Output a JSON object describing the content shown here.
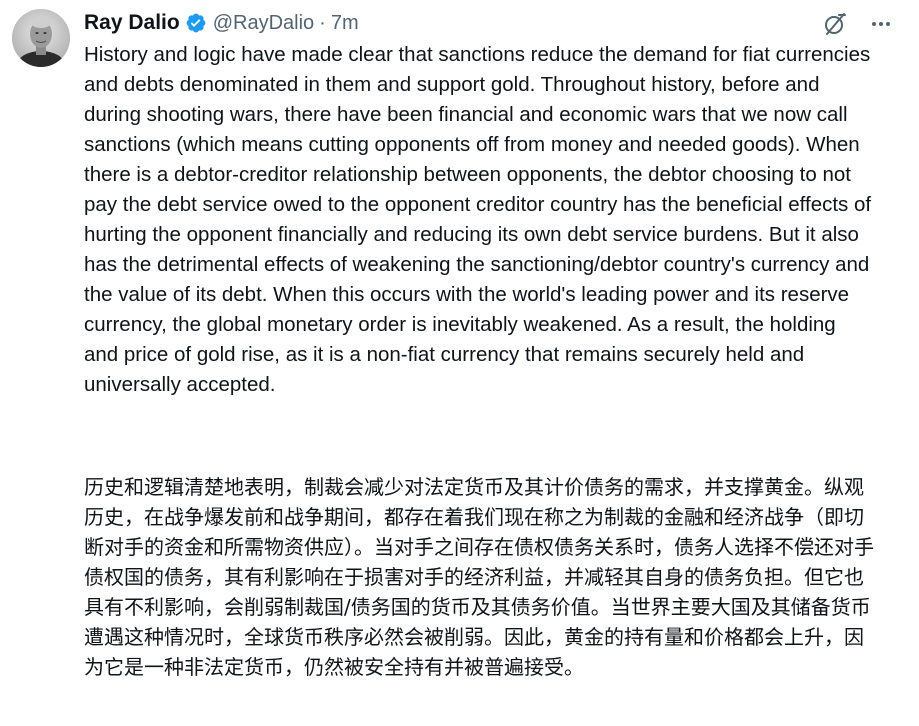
{
  "author": {
    "display_name": "Ray Dalio",
    "handle": "@RayDalio",
    "separator": "·",
    "time": "7m"
  },
  "icons": {
    "verified": "verified-badge-icon",
    "grok": "grok-icon",
    "more": "more-horizontal-icon"
  },
  "colors": {
    "verified_blue": "#1d9bf0",
    "secondary_text": "#536471",
    "primary_text": "#0f1419"
  },
  "tweet": {
    "text_en": "History and logic have made clear that sanctions reduce the demand for fiat currencies and debts denominated in them and support gold. Throughout history, before and during shooting wars, there have been financial and economic wars that we now call sanctions (which means cutting opponents off from money and needed goods). When there is a debtor-creditor relationship between opponents, the debtor choosing to not pay the debt service owed to the opponent creditor country has the beneficial effects of hurting the opponent financially and reducing its own debt service burdens. But it also has the detrimental effects of weakening the sanctioning/debtor country's currency and the value of its debt.  When this occurs with the world's leading power and its reserve currency, the global monetary order is inevitably weakened. As a result, the holding and price of gold rise, as it is a non-fiat currency that remains securely held and universally accepted.",
    "text_cn": "历史和逻辑清楚地表明，制裁会减少对法定货币及其计价债务的需求，并支撑黄金。纵观历史，在战争爆发前和战争期间，都存在着我们现在称之为制裁的金融和经济战争（即切断对手的资金和所需物资供应）。当对手之间存在债权债务关系时，债务人选择不偿还对手债权国的债务，其有利影响在于损害对手的经济利益，并减轻其自身的债务负担。但它也具有不利影响，会削弱制裁国/债务国的货币及其债务价值。当世界主要大国及其储备货币遭遇这种情况时，全球货币秩序必然会被削弱。因此，黄金的持有量和价格都会上升，因为它是一种非法定货币，仍然被安全持有并被普遍接受。"
  }
}
